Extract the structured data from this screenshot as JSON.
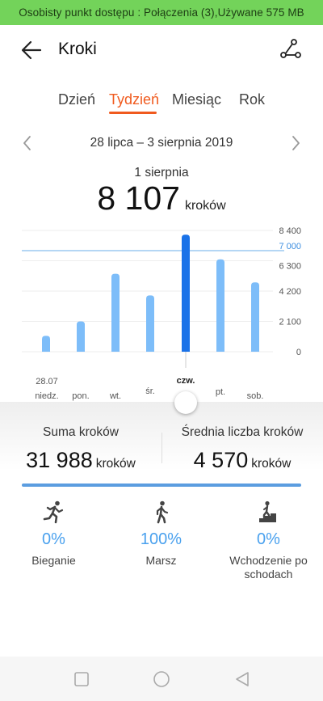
{
  "status_bar": {
    "text": "Osobisty punkt dostępu : Połączenia (3),Używane 575 MB"
  },
  "header": {
    "title": "Kroki",
    "back_icon": "arrow-left-icon",
    "share_icon": "share-icon"
  },
  "tabs": [
    {
      "label": "Dzień",
      "active": false
    },
    {
      "label": "Tydzień",
      "active": true
    },
    {
      "label": "Miesiąc",
      "active": false
    },
    {
      "label": "Rok",
      "active": false
    }
  ],
  "date_range": "28 lipca – 3 sierpnia 2019",
  "selected": {
    "day": "1 sierpnia",
    "value": "8 107",
    "unit": "kroków"
  },
  "colors": {
    "accent": "#f05a1e",
    "bar": "#7dbdf9",
    "bar_selected": "#1a72e8",
    "goal_line": "#6aaee8",
    "status_bar": "#73d35a"
  },
  "chart_data": {
    "type": "bar",
    "categories": [
      "niedz.",
      "pon.",
      "wt.",
      "śr.",
      "czw.",
      "pt.",
      "sob."
    ],
    "first_date_label": "28.07",
    "values": [
      1100,
      2100,
      5400,
      3900,
      8107,
      6400,
      4800
    ],
    "selected_index": 4,
    "goal": 7000,
    "goal_label": "7 000",
    "y_ticks": [
      "8 400",
      "6 300",
      "4 200",
      "2 100",
      "0"
    ],
    "ylim": [
      0,
      8400
    ]
  },
  "stats": {
    "sum": {
      "label": "Suma kroków",
      "value": "31 988",
      "unit": "kroków"
    },
    "avg": {
      "label": "Średnia liczba kroków",
      "value": "4 570",
      "unit": "kroków"
    }
  },
  "activities": [
    {
      "icon": "running-icon",
      "percent": "0%",
      "label": "Bieganie"
    },
    {
      "icon": "walking-icon",
      "percent": "100%",
      "label": "Marsz"
    },
    {
      "icon": "stairs-icon",
      "percent": "0%",
      "label": "Wchodzenie po schodach"
    }
  ],
  "nav_bar": {
    "items": [
      "square-icon",
      "circle-icon",
      "triangle-back-icon"
    ]
  }
}
